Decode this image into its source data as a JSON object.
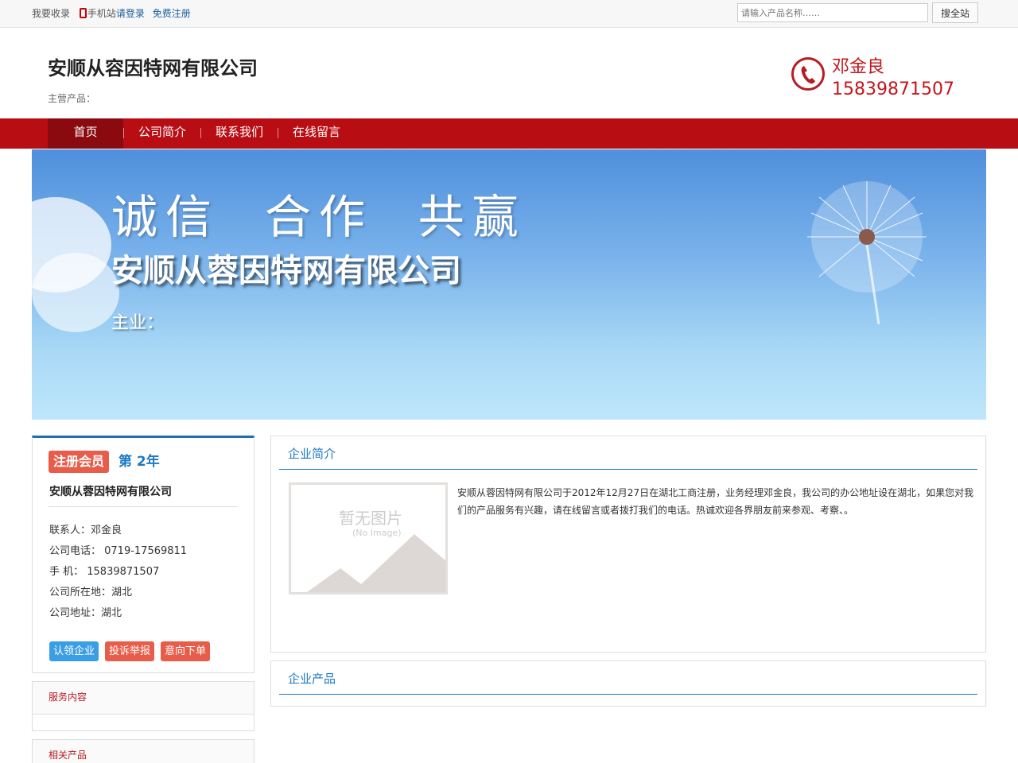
{
  "topbar": {
    "bookmark": "我要收录",
    "mobile": "手机站",
    "login": "请登录",
    "register": "免费注册",
    "search_placeholder": "请输入产品名称……",
    "search_button": "搜全站"
  },
  "header": {
    "company_name": "安顺从容因特网有限公司",
    "main_products": "主营产品：",
    "contact_name": "邓金良",
    "contact_phone": "15839871507"
  },
  "nav": {
    "items": [
      "首页",
      "公司简介",
      "联系我们",
      "在线留言"
    ]
  },
  "banner": {
    "slogan": "诚信  合作  共赢",
    "company_name": "安顺从蓉因特网有限公司",
    "main_business": "主业："
  },
  "card": {
    "member_badge": "注册会员",
    "year_badge": "第 2年",
    "company_name": "安顺从蓉因特网有限公司",
    "contact": "联系人：邓金良",
    "tel": "公司电话： 0719-17569811",
    "mobile": "手  机： 15839871507",
    "location": "公司所在地：湖北",
    "address": "公司地址：湖北",
    "btn_claim": "认领企业",
    "btn_report": "投诉举报",
    "btn_order": "意向下单",
    "colors": {
      "claim": "#3a9ee4",
      "report": "#e85c4a",
      "order": "#e85c4a"
    }
  },
  "sidebar": {
    "services_title": "服务内容",
    "related_title": "相关产品"
  },
  "intro": {
    "title": "企业简介",
    "no_image": "暂无图片",
    "no_image_en": "(No Image)",
    "text": "安顺从蓉因特网有限公司于2012年12月27日在湖北工商注册，业务经理邓金良，我公司的办公地址设在湖北，如果您对我们的产品服务有兴趣，请在线留言或者拨打我们的电话。热诚欢迎各界朋友前来参观、考察、。"
  },
  "products": {
    "title": "企业产品"
  }
}
